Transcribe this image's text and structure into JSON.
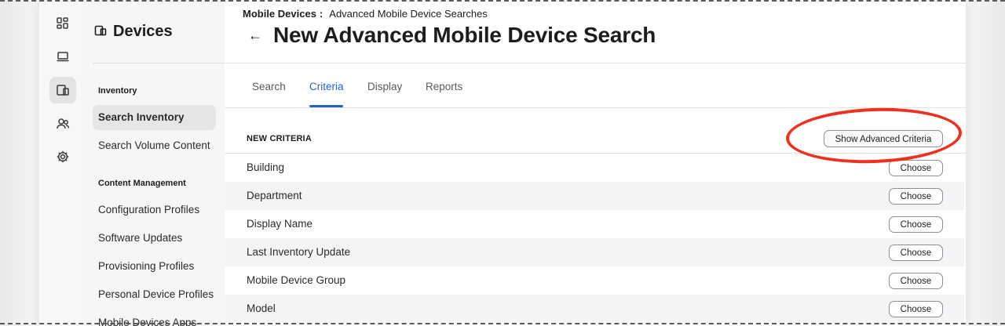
{
  "app": {
    "sidebar_title": "Devices"
  },
  "rail": {
    "icons": [
      "dashboard-icon",
      "computer-icon",
      "mobile-devices-icon",
      "users-icon",
      "settings-icon"
    ]
  },
  "sidebar": {
    "sections": [
      {
        "label": "Inventory",
        "items": [
          {
            "label": "Search Inventory",
            "active": true
          },
          {
            "label": "Search Volume Content",
            "active": false
          }
        ]
      },
      {
        "label": "Content Management",
        "items": [
          {
            "label": "Configuration Profiles",
            "active": false
          },
          {
            "label": "Software Updates",
            "active": false
          },
          {
            "label": "Provisioning Profiles",
            "active": false
          },
          {
            "label": "Personal Device Profiles",
            "active": false
          },
          {
            "label": "Mobile Devices Apps",
            "active": false
          }
        ]
      }
    ]
  },
  "breadcrumb": {
    "parent": "Mobile Devices",
    "separator": ":",
    "current": "Advanced Mobile Device Searches"
  },
  "page": {
    "back_icon": "arrow-left-icon",
    "title": "New Advanced Mobile Device Search"
  },
  "tabs": [
    {
      "label": "Search",
      "active": false
    },
    {
      "label": "Criteria",
      "active": true
    },
    {
      "label": "Display",
      "active": false
    },
    {
      "label": "Reports",
      "active": false
    }
  ],
  "criteria": {
    "heading": "NEW CRITERIA",
    "advanced_button": "Show Advanced Criteria",
    "choose_label": "Choose",
    "rows": [
      "Building",
      "Department",
      "Display Name",
      "Last Inventory Update",
      "Mobile Device Group",
      "Model"
    ]
  },
  "colors": {
    "accent": "#2563c7",
    "annotation": "#f0301e"
  }
}
